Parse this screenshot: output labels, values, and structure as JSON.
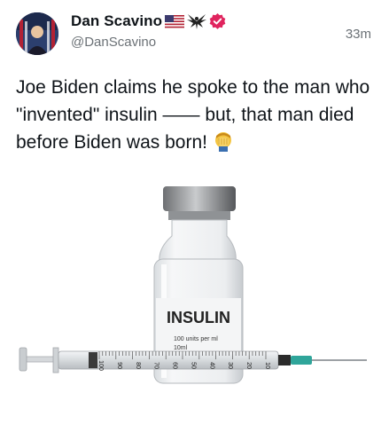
{
  "post": {
    "author_name": "Dan Scavino",
    "author_handle": "@DanScavino",
    "timestamp": "33m",
    "badges": [
      "us-flag-icon",
      "eagle-icon",
      "verified-badge-icon"
    ],
    "text": "Joe Biden claims he spoke to the man who \"invented\" insulin —— but, that man died before Biden was born!",
    "emoji": "face-palm-icon",
    "colors": {
      "verified": "#e0245e",
      "text": "#0f1419",
      "muted": "#6b7176"
    }
  },
  "image": {
    "label_title": "INSULIN",
    "label_line1": "100 units per ml",
    "label_line2": "10ml",
    "syringe_scale": [
      "100",
      "90",
      "80",
      "70",
      "60",
      "50",
      "40",
      "30",
      "20",
      "10"
    ]
  }
}
